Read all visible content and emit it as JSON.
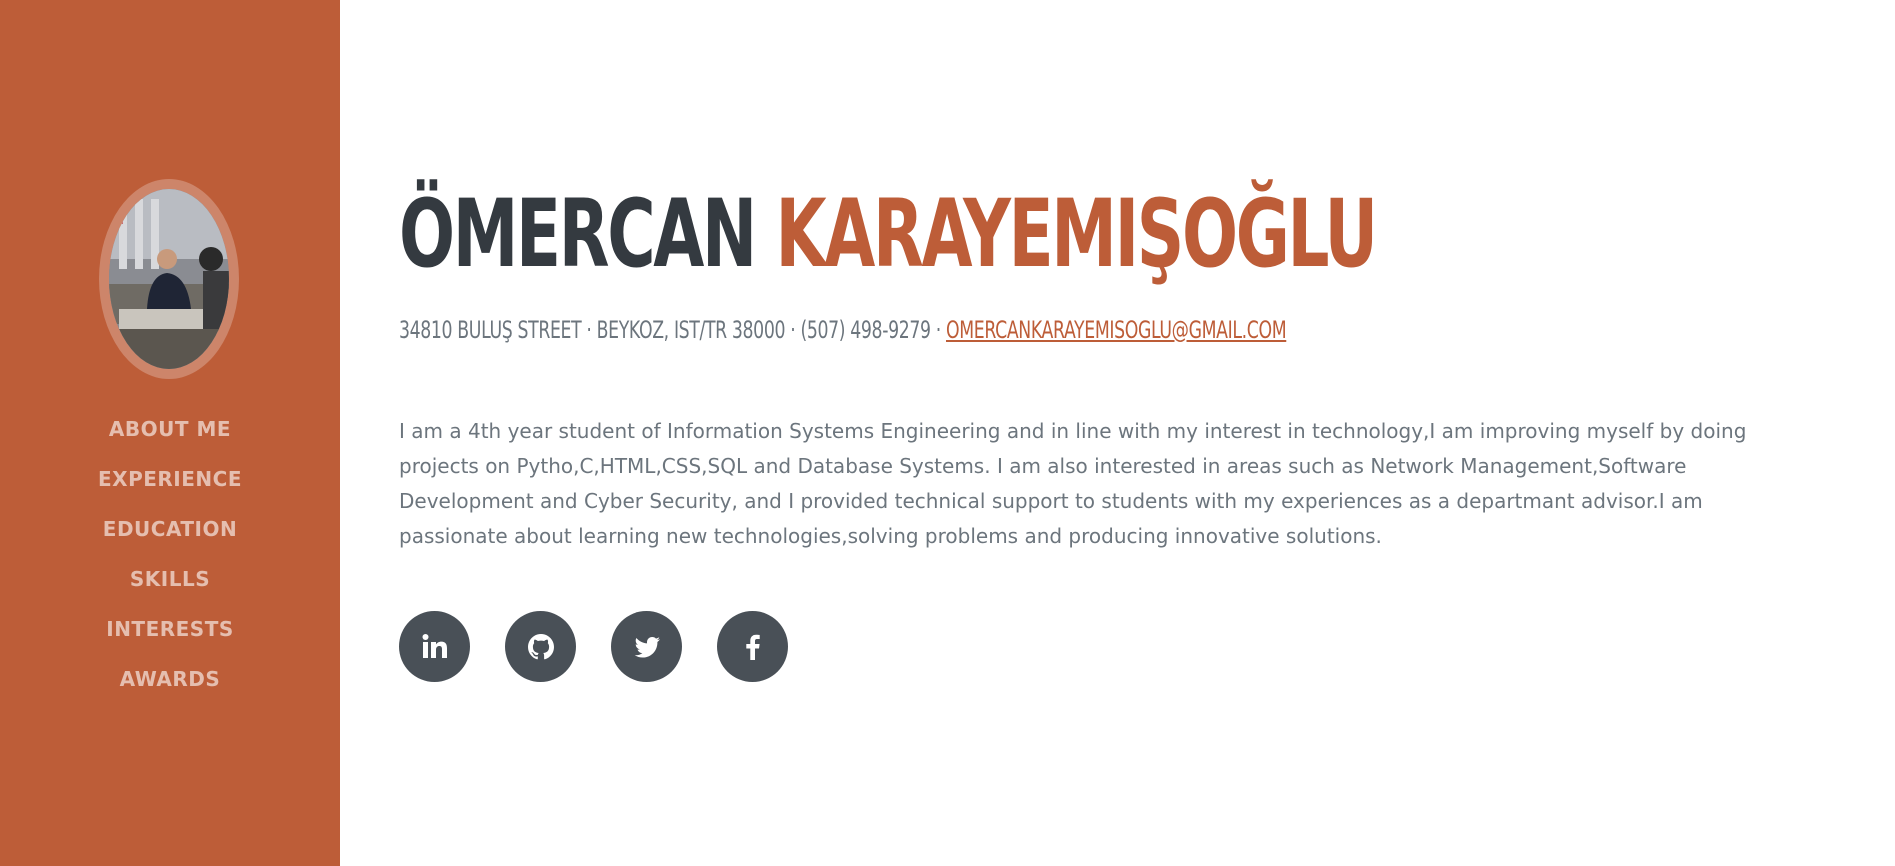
{
  "profile": {
    "first_name": "ÖMERCAN",
    "last_name": "KARAYEMIŞOĞLU",
    "address": "34810 BULUŞ STREET · BEYKOZ, IST/TR 38000 · (507) 498-9279 · ",
    "email": "OMERCANKARAYEMISOGLU@GMAIL.COM",
    "bio": "I am a 4th year student of Information Systems Engineering and in line with my interest in technology,I am improving myself by doing projects on Pytho,C,HTML,CSS,SQL and Database Systems. I am also interested in areas such as Network Management,Software Development and Cyber Security, and I provided technical support to students with my experiences as a departmant advisor.I am passionate about learning new technologies,solving problems and producing innovative solutions."
  },
  "nav": {
    "items": [
      {
        "label": "ABOUT ME"
      },
      {
        "label": "EXPERIENCE"
      },
      {
        "label": "EDUCATION"
      },
      {
        "label": "SKILLS"
      },
      {
        "label": "INTERESTS"
      },
      {
        "label": "AWARDS"
      }
    ]
  },
  "social": [
    {
      "icon": "linkedin-icon"
    },
    {
      "icon": "github-icon"
    },
    {
      "icon": "twitter-icon"
    },
    {
      "icon": "facebook-icon"
    }
  ],
  "colors": {
    "primary": "#bd5d38",
    "dark": "#343a40",
    "muted": "#6c757d",
    "social_bg": "#495057"
  }
}
